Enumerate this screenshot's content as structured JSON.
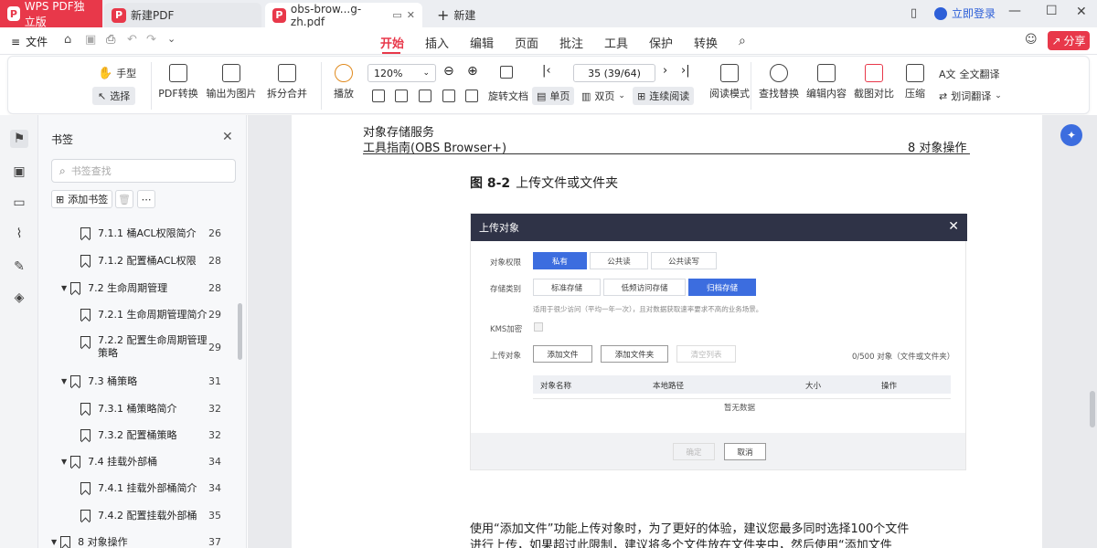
{
  "tabs": {
    "wps": "WPS PDF独立版",
    "new_pdf": "新建PDF",
    "doc": "obs-brow...g-zh.pdf",
    "add": "新建"
  },
  "titlebar": {
    "login": "立即登录",
    "share": "分享"
  },
  "menu": {
    "file": "文件",
    "items": [
      "开始",
      "插入",
      "编辑",
      "页面",
      "批注",
      "工具",
      "保护",
      "转换"
    ],
    "active": "开始"
  },
  "toolbar": {
    "hand": "手型",
    "select": "选择",
    "pdf_convert": "PDF转换",
    "export_image": "输出为图片",
    "split_merge": "拆分合并",
    "play": "播放",
    "zoom": "120%",
    "page_field": "35 (39/64)",
    "rotate": "旋转文档",
    "single": "单页",
    "double": "双页",
    "continuous": "连续阅读",
    "read_mode": "阅读模式",
    "find_replace": "查找替换",
    "edit_content": "编辑内容",
    "screenshot_compare": "截图对比",
    "compress": "压缩",
    "full_translate": "全文翻译",
    "word_translate": "划词翻译"
  },
  "bookmarks": {
    "title": "书签",
    "search_placeholder": "书签查找",
    "add": "添加书签",
    "items": [
      {
        "label": "7.1.1 桶ACL权限简介",
        "page": "26",
        "level": 3
      },
      {
        "label": "7.1.2 配置桶ACL权限",
        "page": "28",
        "level": 3
      },
      {
        "label": "7.2 生命周期管理",
        "page": "28",
        "level": 2
      },
      {
        "label": "7.2.1 生命周期管理简介",
        "page": "29",
        "level": 3
      },
      {
        "label": "7.2.2 配置生命周期管理",
        "label2": "策略",
        "page": "29",
        "level": 3
      },
      {
        "label": "7.3 桶策略",
        "page": "31",
        "level": 2
      },
      {
        "label": "7.3.1 桶策略简介",
        "page": "32",
        "level": 3
      },
      {
        "label": "7.3.2 配置桶策略",
        "page": "32",
        "level": 3
      },
      {
        "label": "7.4 挂载外部桶",
        "page": "34",
        "level": 2
      },
      {
        "label": "7.4.1 挂载外部桶简介",
        "page": "34",
        "level": 3
      },
      {
        "label": "7.4.2 配置挂载外部桶",
        "page": "35",
        "level": 3
      },
      {
        "label": "8 对象操作",
        "page": "37",
        "level": 1
      }
    ]
  },
  "document": {
    "header_left_1": "对象存储服务",
    "header_left_2": "工具指南(OBS Browser+)",
    "header_right": "8 对象操作",
    "figure_caption_bold": "图 8-2",
    "figure_caption": "上传文件或文件夹",
    "figure": {
      "title": "上传对象",
      "perm_label": "对象权限",
      "perm_options": [
        "私有",
        "公共读",
        "公共读写"
      ],
      "storage_label": "存储类别",
      "storage_options": [
        "标准存储",
        "低频访问存储",
        "归档存储"
      ],
      "storage_note": "适用于很少访问（平均一年一次），且对数据获取速率要求不高的业务场景。",
      "kms_label": "KMS加密",
      "upload_label": "上传对象",
      "add_file": "添加文件",
      "add_folder": "添加文件夹",
      "clear_list": "清空列表",
      "count": "0/500 对象（文件或文件夹）",
      "columns": [
        "对象名称",
        "本地路径",
        "大小",
        "操作"
      ],
      "empty": "暂无数据",
      "ok": "确定",
      "cancel": "取消"
    },
    "body_line1": "使用“添加文件”功能上传对象时，为了更好的体验，建议您最多同时选择100个文件",
    "body_line2": "进行上传，如果超过此限制，建议将多个文件放在文件夹中，然后使用“添加文件"
  }
}
